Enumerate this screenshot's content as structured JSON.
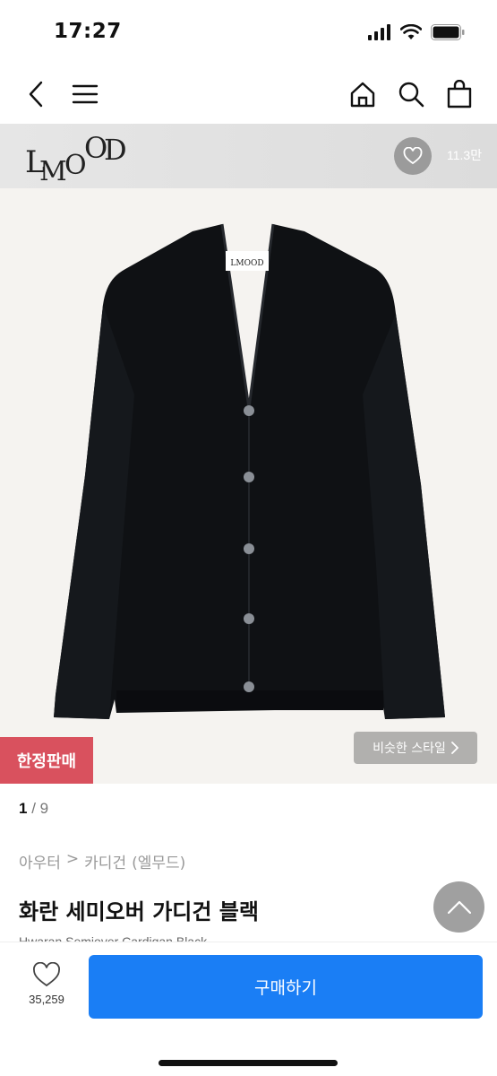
{
  "status_bar": {
    "time": "17:27"
  },
  "brand": {
    "logo_text": "LMOOD",
    "like_count": "11.3만"
  },
  "product": {
    "badge": "한정판매",
    "similar_style_label": "비슷한 스타일",
    "image_index": "1",
    "image_total": "/ 9",
    "breadcrumb": [
      "아우터",
      ">",
      "카디건",
      "(엘무드)"
    ],
    "title": "화란 세미오버 가디건 블랙",
    "subtitle": "Hwaran Semiover Cardigan Black",
    "color": "#0d0f12"
  },
  "bottom_bar": {
    "wish_count": "35,259",
    "buy_label": "구매하기"
  },
  "colors": {
    "accent": "#1a7ef5",
    "badge": "#d9515e"
  }
}
